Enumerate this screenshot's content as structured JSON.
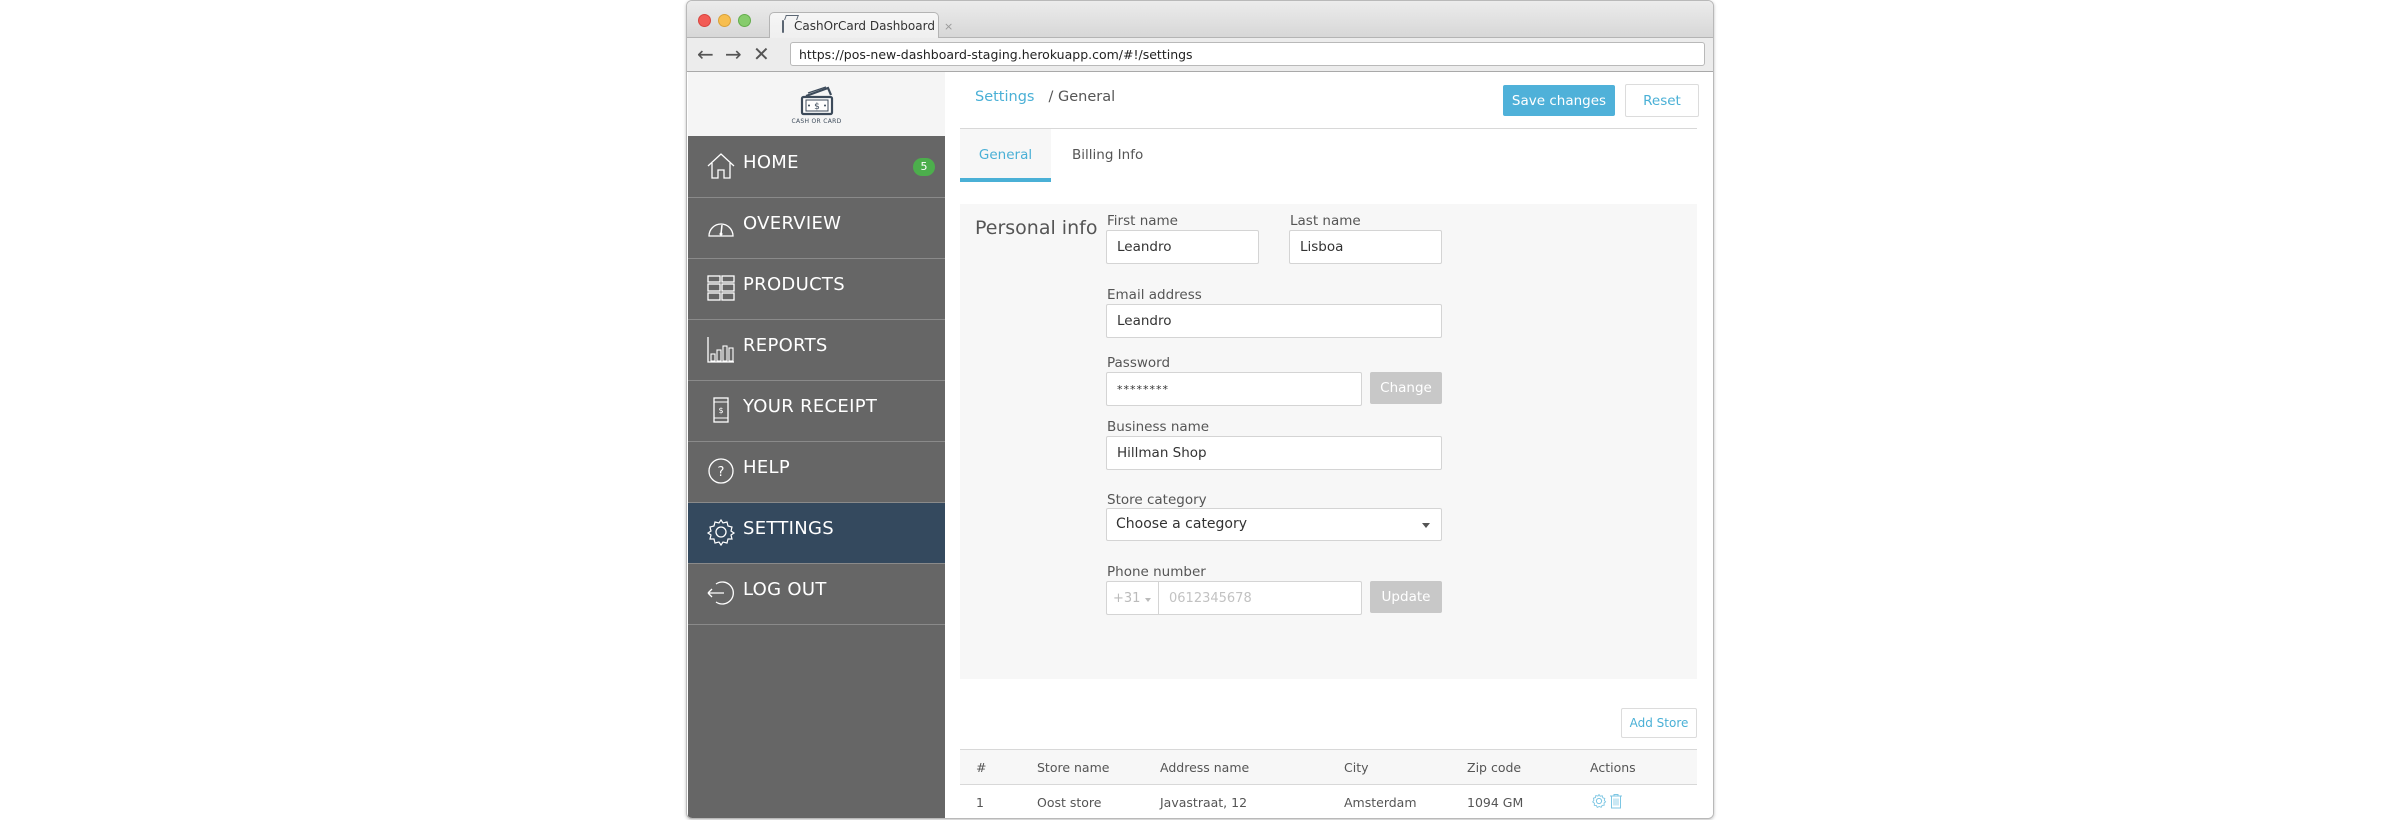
{
  "browser": {
    "tab_title": "CashOrCard Dashboard",
    "tab_close": "×",
    "url": "https://pos-new-dashboard-staging.herokuapp.com/#!/settings",
    "back_icon": "←",
    "forward_icon": "→",
    "stop_icon": "✕"
  },
  "sidebar": {
    "logo_caption": "CASH OR CARD",
    "items": [
      {
        "label": "HOME",
        "icon": "home-icon",
        "badge": "5",
        "active": false
      },
      {
        "label": "OVERVIEW",
        "icon": "gauge-icon",
        "active": false
      },
      {
        "label": "PRODUCTS",
        "icon": "grid-icon",
        "active": false
      },
      {
        "label": "REPORTS",
        "icon": "bar-chart-icon",
        "active": false
      },
      {
        "label": "YOUR RECEIPT",
        "icon": "receipt-icon",
        "active": false
      },
      {
        "label": "HELP",
        "icon": "help-icon",
        "active": false
      },
      {
        "label": "SETTINGS",
        "icon": "gear-icon",
        "active": true
      },
      {
        "label": "LOG OUT",
        "icon": "logout-icon",
        "active": false
      }
    ]
  },
  "header": {
    "breadcrumb_root": "Settings",
    "breadcrumb_current": "/ General",
    "save_label": "Save changes",
    "reset_label": "Reset"
  },
  "tabs": [
    {
      "label": "General",
      "active": true
    },
    {
      "label": "Billing Info",
      "active": false
    }
  ],
  "personal_info": {
    "title": "Personal info",
    "first_name_label": "First name",
    "first_name_value": "Leandro",
    "last_name_label": "Last name",
    "last_name_value": "Lisboa",
    "email_label": "Email address",
    "email_value": "Leandro",
    "password_label": "Password",
    "password_value": "********",
    "change_label": "Change",
    "business_label": "Business name",
    "business_value": "Hillman Shop",
    "category_label": "Store category",
    "category_value": "Choose a category",
    "phone_label": "Phone number",
    "phone_code": "+31",
    "phone_placeholder": "0612345678",
    "update_label": "Update"
  },
  "stores": {
    "add_label": "Add Store",
    "columns": [
      "#",
      "Store name",
      "Address name",
      "City",
      "Zip code",
      "Actions"
    ],
    "rows": [
      {
        "num": "1",
        "store_name": "Oost store",
        "address": "Javastraat, 12",
        "city": "Amsterdam",
        "zip": "1094 GM"
      }
    ]
  },
  "colors": {
    "accent": "#4ab0d6",
    "sidebar_bg": "#666666",
    "sidebar_active": "#34495e",
    "badge": "#4cae4c"
  }
}
